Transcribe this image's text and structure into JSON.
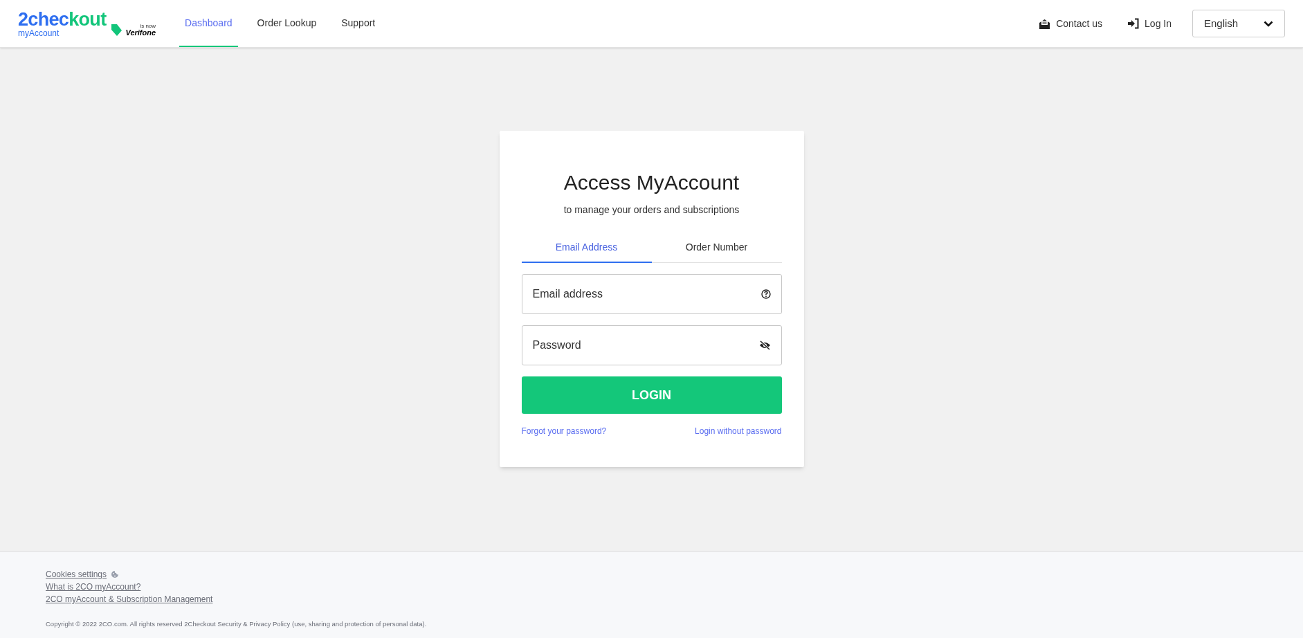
{
  "logo": {
    "brand_start": "2chec",
    "brand_end": "kout",
    "sub": "myAccount",
    "note": "is now",
    "partner": "Verifone"
  },
  "nav": [
    {
      "label": "Dashboard",
      "selected": true
    },
    {
      "label": "Order Lookup",
      "selected": false
    },
    {
      "label": "Support",
      "selected": false
    }
  ],
  "header_actions": [
    {
      "kind": "contact",
      "label": "Contact us"
    },
    {
      "kind": "login",
      "label": "Log In"
    }
  ],
  "language": {
    "value": "English"
  },
  "card": {
    "title": "Access MyAccount",
    "subtitle": "to manage your orders and subscriptions",
    "tabs": [
      {
        "label": "Email Address",
        "selected": true
      },
      {
        "label": "Order Number",
        "selected": false
      }
    ],
    "fields": [
      {
        "kind": "help",
        "placeholder": "Email address"
      },
      {
        "kind": "reveal",
        "placeholder": "Password"
      }
    ],
    "button": "LOGIN",
    "links": [
      "Forgot your password?",
      "Login without password"
    ]
  },
  "footer": {
    "links": [
      {
        "label": "Cookies settings",
        "kind": "cookie"
      },
      {
        "label": "What is 2CO myAccount?",
        "kind": "plain"
      },
      {
        "label": "2CO myAccount & Subscription Management",
        "kind": "plain"
      }
    ],
    "copyright": "Copyright © 2022 2CO.com. All rights reserved 2Checkout Security & Privacy Policy (use, sharing and protection of personal data)."
  }
}
